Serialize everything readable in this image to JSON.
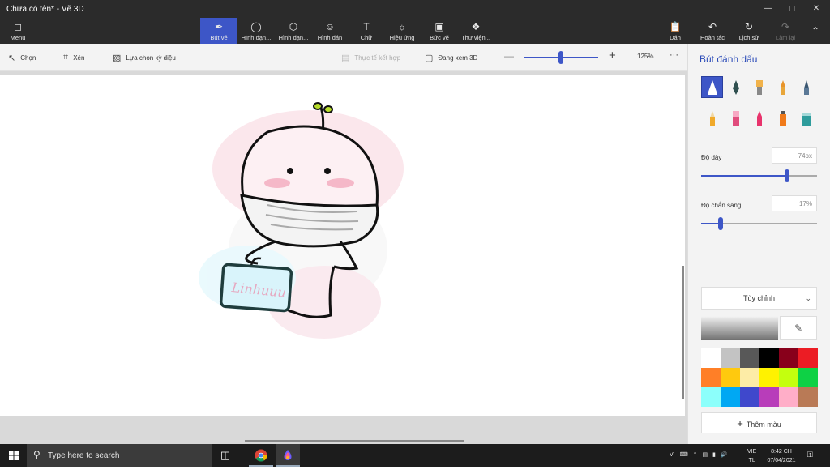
{
  "window": {
    "title": "Chưa có tên* - Vẽ 3D"
  },
  "ribbon": {
    "menu_label": "Menu",
    "tools": [
      {
        "label": "Bút vẽ",
        "icon": "brush-icon",
        "active": true
      },
      {
        "label": "Hình dạn...",
        "icon": "2d-shapes-icon"
      },
      {
        "label": "Hình dạn...",
        "icon": "3d-shapes-icon"
      },
      {
        "label": "Hình dán",
        "icon": "stickers-icon"
      },
      {
        "label": "Chữ",
        "icon": "text-icon"
      },
      {
        "label": "Hiệu ứng",
        "icon": "effects-icon"
      },
      {
        "label": "Bức vẽ",
        "icon": "canvas-icon"
      },
      {
        "label": "Thư viện...",
        "icon": "library-icon"
      }
    ],
    "right": [
      {
        "label": "Dán",
        "icon": "paste-icon"
      },
      {
        "label": "Hoàn tác",
        "icon": "undo-icon"
      },
      {
        "label": "Lịch sử",
        "icon": "history-icon"
      },
      {
        "label": "Làm lại",
        "icon": "redo-icon",
        "disabled": true
      }
    ]
  },
  "toolbar": {
    "select": "Chọn",
    "crop": "Xén",
    "magic_select": "Lựa chọn kỳ diệu",
    "mixed_reality": "Thực tế kết hợp",
    "view_3d": "Đang xem 3D",
    "zoom": "125%",
    "zoom_level": 0.5,
    "more": "···"
  },
  "canvas": {
    "doodle_text": "Linhuuu",
    "colors": {
      "outline": "#111111",
      "blush": "#f5b8c8",
      "leaf": "#b6dc2a",
      "case_fill": "#d9f4fb",
      "case_text": "#e6a8c0"
    }
  },
  "panel": {
    "title": "Bút đánh dấu",
    "thickness_label": "Độ dày",
    "thickness_value": "74px",
    "thickness_pct": 0.74,
    "opacity_label": "Độ chắn sáng",
    "opacity_value": "17%",
    "opacity_pct": 0.17,
    "custom_label": "Tùy chỉnh",
    "add_color": "Thêm màu",
    "brushes": [
      "marker",
      "calligraphy-pen",
      "oil-brush",
      "watercolor",
      "pixel-pen",
      "pencil",
      "eraser",
      "crayon",
      "spray-can",
      "fill"
    ],
    "swatches": [
      "#ffffff",
      "#c3c3c3",
      "#585858",
      "#000000",
      "#88001b",
      "#ec1c24",
      "#ff7f27",
      "#ffc90e",
      "#fdeca6",
      "#fff200",
      "#c4ff0e",
      "#0ed145",
      "#8cfffb",
      "#00a8f3",
      "#3f48cc",
      "#b83dba",
      "#ffaec8",
      "#b97a56"
    ]
  },
  "taskbar": {
    "search_placeholder": "Type here to search",
    "lang_top": "VIE",
    "lang_bottom": "TL",
    "time": "8:42 CH",
    "date": "07/04/2021",
    "notification_count": "1"
  }
}
